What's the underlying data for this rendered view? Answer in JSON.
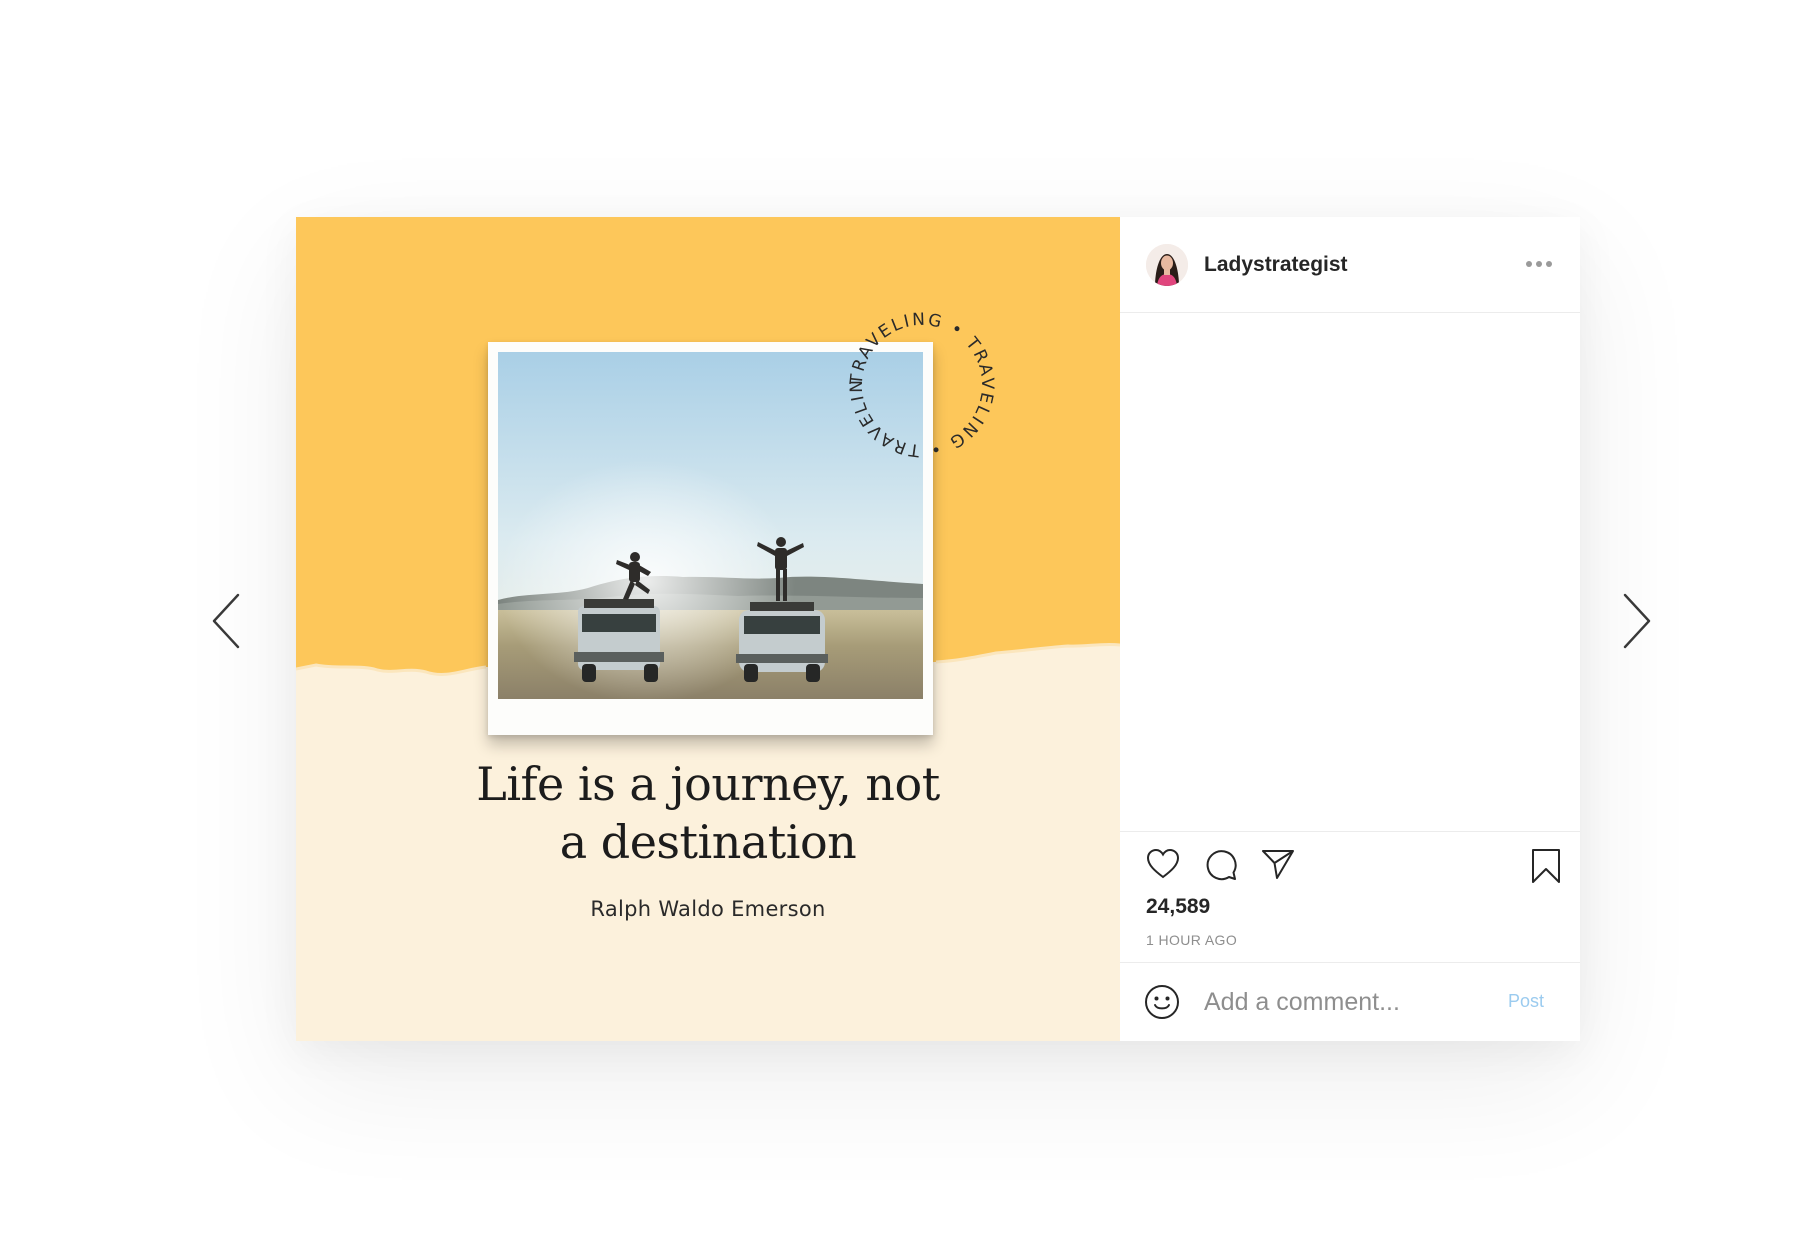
{
  "navigation": {
    "prev_icon": "chevron-left-icon",
    "next_icon": "chevron-right-icon"
  },
  "post": {
    "background_colors": {
      "top": "#fdc75a",
      "bottom": "#fcf1dc"
    },
    "stamp_words": [
      "TRAVELING",
      "TRAVELING",
      "TRAVELING"
    ],
    "quote_lines": [
      "Life is a journey, not",
      "a destination"
    ],
    "author": "Ralph Waldo Emerson"
  },
  "panel": {
    "username": "Ladystrategist",
    "more_icon": "more-dots-icon",
    "likes": "24,589",
    "timestamp": "1 HOUR AGO",
    "actions": [
      "heart-icon",
      "comment-icon",
      "send-icon",
      "bookmark-icon"
    ],
    "comment": {
      "placeholder": "Add a comment...",
      "value": "",
      "post_label": "Post"
    }
  }
}
